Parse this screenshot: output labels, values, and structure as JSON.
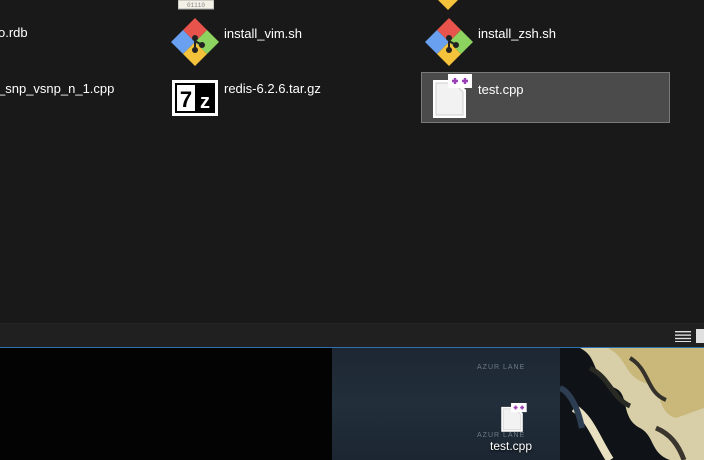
{
  "explorer": {
    "files": [
      {
        "name": "o.rdb"
      },
      {
        "name": "install_vim.sh"
      },
      {
        "name": "install_zsh.sh"
      },
      {
        "name": "_snp_vsnp_n_1.cpp"
      },
      {
        "name": "redis-6.2.6.tar.gz"
      },
      {
        "name": "test.cpp",
        "selected": true
      }
    ]
  },
  "desktop": {
    "icons": [
      {
        "name": "test.cpp"
      }
    ],
    "wallpaper_text": [
      "AZUR LANE",
      "AZUR LANE"
    ]
  },
  "colors": {
    "explorer_bg": "#191919",
    "selection": "#4b4b4b",
    "git_red": "#e8534b",
    "git_green": "#8dd35f",
    "git_blue": "#6aa0f0",
    "git_yellow": "#f5c23c",
    "cpp_accent": "#9b3fb5"
  }
}
